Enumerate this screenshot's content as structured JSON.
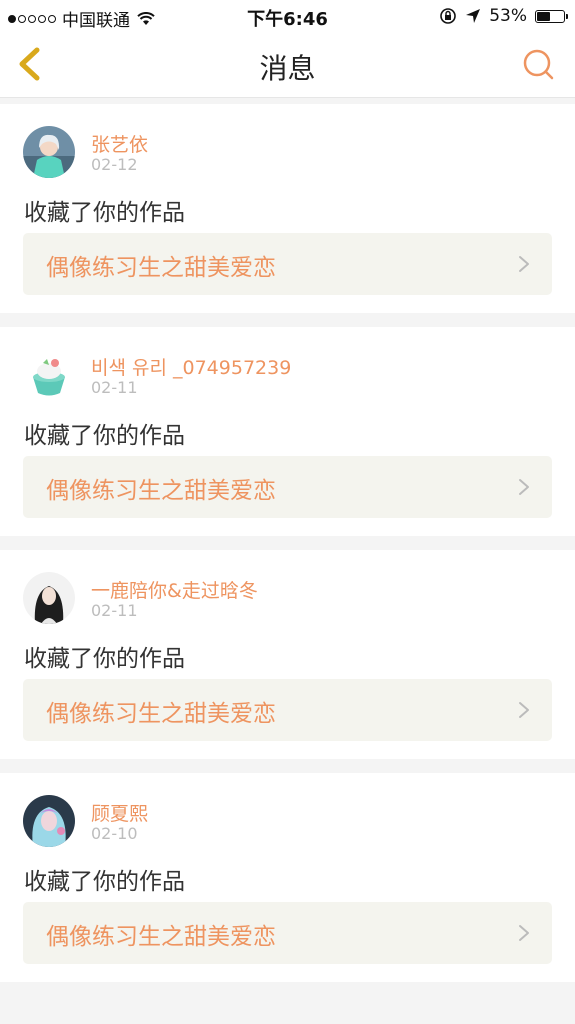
{
  "status_bar": {
    "carrier": "中国联通",
    "time": "下午6:46",
    "battery": "53%",
    "battery_level": 0.53
  },
  "nav": {
    "title": "消息",
    "back_icon": "chevron-left-icon",
    "search_icon": "search-icon"
  },
  "messages": [
    {
      "user": "张艺依",
      "date": "02-12",
      "action": "收藏了你的作品",
      "work": "偶像练习生之甜美爱恋"
    },
    {
      "user": "비색 유리 _074957239",
      "date": "02-11",
      "action": "收藏了你的作品",
      "work": "偶像练习生之甜美爱恋"
    },
    {
      "user": "一鹿陪你&走过晗冬",
      "date": "02-11",
      "action": "收藏了你的作品",
      "work": "偶像练习生之甜美爱恋"
    },
    {
      "user": "顾夏熙",
      "date": "02-10",
      "action": "收藏了你的作品",
      "work": "偶像练习生之甜美爱恋"
    }
  ],
  "colors": {
    "accent": "#ee9460",
    "back_icon": "#d9a91c",
    "date": "#bdbdbd",
    "work_bg": "#f4f4ee"
  }
}
